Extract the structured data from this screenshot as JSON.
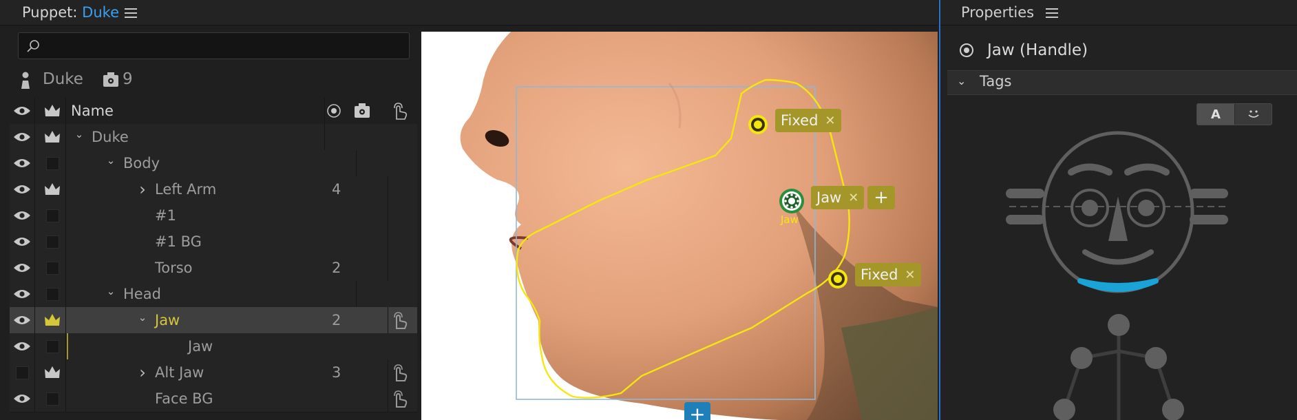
{
  "puppet_panel": {
    "title_prefix": "Puppet: ",
    "title_name": "Duke",
    "search": {
      "value": "",
      "placeholder": ""
    },
    "puppet_name": "Duke",
    "behavior_count": "9"
  },
  "table": {
    "header": {
      "name": "Name"
    },
    "rows": [
      {
        "name": "Duke",
        "count": "",
        "depth": 0,
        "chevron": "down",
        "eye": true,
        "crown": true,
        "trigger": false,
        "selected": false
      },
      {
        "name": "Body",
        "count": "",
        "depth": 1,
        "chevron": "down",
        "eye": true,
        "crown": false,
        "trigger": false,
        "selected": false
      },
      {
        "name": "Left Arm",
        "count": "4",
        "depth": 2,
        "chevron": "right",
        "eye": true,
        "crown": true,
        "trigger": false,
        "selected": false
      },
      {
        "name": "#1",
        "count": "",
        "depth": 2,
        "chevron": "",
        "eye": true,
        "crown": false,
        "trigger": false,
        "selected": false
      },
      {
        "name": "#1 BG",
        "count": "",
        "depth": 2,
        "chevron": "",
        "eye": true,
        "crown": false,
        "trigger": false,
        "selected": false
      },
      {
        "name": "Torso",
        "count": "2",
        "depth": 2,
        "chevron": "",
        "eye": true,
        "crown": false,
        "trigger": false,
        "selected": false
      },
      {
        "name": "Head",
        "count": "",
        "depth": 1,
        "chevron": "down",
        "eye": true,
        "crown": false,
        "trigger": false,
        "selected": false
      },
      {
        "name": "Jaw",
        "count": "2",
        "depth": 2,
        "chevron": "down",
        "eye": true,
        "crown": true,
        "trigger": true,
        "selected": true
      },
      {
        "name": "Jaw",
        "count": "",
        "depth": 3,
        "chevron": "",
        "eye": true,
        "crown": false,
        "trigger": false,
        "selected": false
      },
      {
        "name": "Alt Jaw",
        "count": "3",
        "depth": 2,
        "chevron": "right",
        "eye": false,
        "crown": true,
        "trigger": true,
        "selected": false
      },
      {
        "name": "Face BG",
        "count": "",
        "depth": 2,
        "chevron": "",
        "eye": true,
        "crown": false,
        "trigger": true,
        "selected": false
      }
    ]
  },
  "canvas": {
    "tags": {
      "fixed_top": "Fixed",
      "jaw": "Jaw",
      "fixed_bottom": "Fixed"
    },
    "handle_caption": "Jaw",
    "close_symbol": "✕",
    "add_symbol": "+"
  },
  "properties": {
    "title": "Properties",
    "handle_label": "Jaw (Handle)",
    "section_label": "Tags",
    "toggle_text": "A",
    "toggle_face": "◡̈"
  },
  "colors": {
    "accent": "#3aa0f0",
    "selected_text": "#d6c63a",
    "tag_fill": "#a49628",
    "outline": "#f5e60f",
    "handle_green": "#2a8f3a",
    "bounding_box": "#8fb8d8",
    "face_mouth": "#1aa3d6"
  }
}
